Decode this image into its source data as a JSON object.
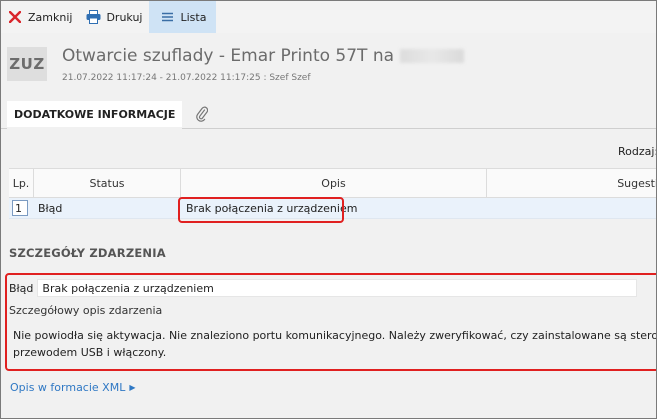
{
  "toolbar": {
    "close_label": "Zamknij",
    "print_label": "Drukuj",
    "list_label": "Lista"
  },
  "header": {
    "badge": "ZUZ",
    "title": "Otwarcie szuflady - Emar Printo 57T na",
    "subtitle": "21.07.2022 11:17:24 - 21.07.2022 11:17:25 : Szef Szef"
  },
  "tabs": {
    "active_label": "DODATKOWE INFORMACJE"
  },
  "filter": {
    "rodzaj_label": "Rodzaj:"
  },
  "table": {
    "columns": [
      "Lp.",
      "Status",
      "Opis",
      "Sugesti"
    ],
    "rows": [
      {
        "lp": "1",
        "status": "Błąd",
        "opis": "Brak połączenia z urządzeniem",
        "sug": ""
      }
    ]
  },
  "details": {
    "section_title": "SZCZEGÓŁY ZDARZENIA",
    "type_label": "Błąd",
    "type_value": "Brak połączenia z urządzeniem",
    "desc_label": "Szczegółowy opis zdarzenia",
    "desc_line1": "Nie powiodła się aktywacja. Nie znaleziono portu komunikacyjnego. Należy zweryfikować, czy zainstalowane są sterowniki USB, a termi",
    "desc_line2": "przewodem USB i włączony."
  },
  "link": {
    "xml_label": "Opis w formacie XML"
  },
  "colors": {
    "accent_blue": "#2f78c4",
    "highlight_red": "#e02020",
    "active_tab_bg": "#cfe3f5",
    "selected_row_bg": "#eaf2fb"
  },
  "icons": {
    "close": "close-icon",
    "print": "printer-icon",
    "list": "list-icon",
    "attachment": "paperclip-icon"
  }
}
